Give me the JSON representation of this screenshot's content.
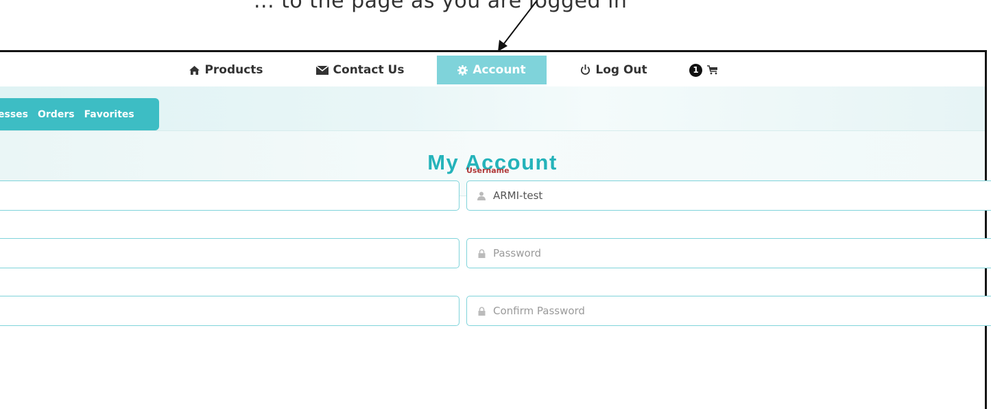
{
  "caption": "... to the page as you are logged in",
  "nav": {
    "products_label": "Products",
    "contact_label": "Contact Us",
    "account_label": "Account",
    "logout_label": "Log Out",
    "cart_count": "1"
  },
  "subnav": {
    "tabs": [
      "esses",
      "Orders",
      "Favorites"
    ]
  },
  "page": {
    "title": "My Account"
  },
  "form": {
    "username_label": "Username",
    "username_value": "ARMI-test",
    "password_placeholder": "Password",
    "confirm_placeholder": "Confirm Password"
  },
  "colors": {
    "accent": "#3dbdc4",
    "active_tab": "#7fd3da",
    "title": "#25b3ba",
    "label": "#b03a3a"
  },
  "icons": {
    "products": "home-icon",
    "contact": "envelope-icon",
    "account": "gear-icon",
    "logout": "power-icon",
    "cart": "cart-icon",
    "username": "user-icon",
    "password": "lock-icon"
  }
}
